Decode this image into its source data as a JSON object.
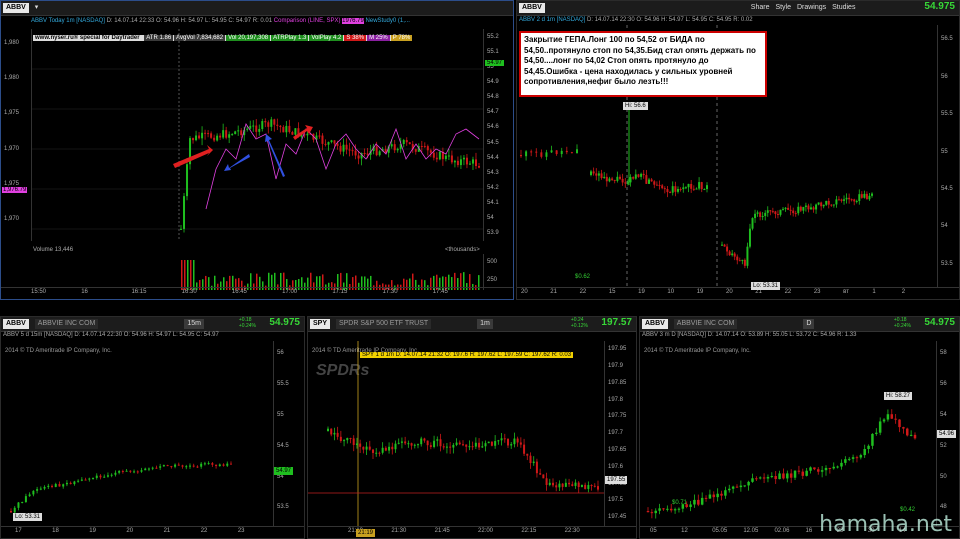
{
  "colors": {
    "up": "#1fbf1f",
    "down": "#d01818",
    "price": "#37d737",
    "compare": "#e040e0",
    "bg": "#000000"
  },
  "p1": {
    "symbol": "ABBV",
    "title": "ABBV Today 1m [NASDAQ]",
    "ohlc": {
      "d": "D: 14.07.14 22:33",
      "o": "O: 54.96",
      "h": "H: 54.97",
      "l": "L: 54.95",
      "c": "C: 54.97",
      "r": "R: 0.01"
    },
    "comparison": "Comparison (LINE, SPX)",
    "comparison_val": "1976.79",
    "newstudy": "NewStudy0 (1,...",
    "site": "www.nyser.ru® special for Daytrader",
    "chips": [
      {
        "t": "ATR 1.86",
        "c": "#3a3a3a"
      },
      {
        "t": "AvgVol 7,834,682",
        "c": "#3a3a3a"
      },
      {
        "t": "Vol 20,197,308",
        "c": "#1f8f1f"
      },
      {
        "t": "ATRPlay 1.3",
        "c": "#1f8f1f"
      },
      {
        "t": "VolPlay 4.2",
        "c": "#1f8f1f"
      },
      {
        "t": "S 38%",
        "c": "#d01818"
      },
      {
        "t": "M 25%",
        "c": "#8a1fa0"
      },
      {
        "t": "P 78%",
        "c": "#c8a020"
      }
    ],
    "price_label": "54.97",
    "left_axis": [
      "1,980",
      "1,980",
      "1,975",
      "1,970",
      "1,975",
      "1,970"
    ],
    "right_axis": [
      "55.2",
      "55.1",
      "55",
      "54.9",
      "54.8",
      "54.7",
      "54.6",
      "54.5",
      "54.4",
      "54.3",
      "54.2",
      "54.1",
      "54",
      "53.9"
    ],
    "left_marker": "1,976.79",
    "volume_label": "Volume",
    "volume_value": "13,446",
    "thousands": "<thousands>",
    "vol_axis": [
      "500",
      "250"
    ],
    "xaxis": [
      "15:50",
      "16",
      "16:15",
      "16:30",
      "16:45",
      "17:00",
      "17:15",
      "17:30",
      "17:45"
    ],
    "time_chip": "2014 © 13.4"
  },
  "p2": {
    "symbol": "ABBV",
    "title": "ABBV 2 d 1m [NASDAQ]",
    "ohlc": {
      "d": "D: 14.07.14 22:30",
      "o": "O: 54.96",
      "h": "H: 54.97",
      "l": "L: 54.95",
      "c": "C: 54.95",
      "r": "R: 0.02"
    },
    "price": "54.975",
    "hi": "Hi: 56.6",
    "lo": "Lo: 53.31",
    "tag1": "$0.62",
    "right_axis": [
      "56.5",
      "56",
      "55.5",
      "55",
      "54.5",
      "54",
      "53.5"
    ],
    "xaxis": [
      "20",
      "21",
      "22",
      "15",
      "19",
      "10",
      "19",
      "20",
      "21",
      "22",
      "23",
      "вт",
      "1",
      "2"
    ]
  },
  "note": "Закрытие ГЕПА.Лонг 100 по 54,52 от БИДА по 54,50..протянуло стоп по 54,35.Бид стал опять держать по 54,50....лонг по 54,02 Стоп опять протянуло до 54,45.Ошибка - цена находилась у сильных уровней сопротивления,нефиг было лезть!!!",
  "p3": {
    "symbol": "ABBV",
    "desc": "ABBVIE INC COM",
    "tf": "15m",
    "price": "54.975",
    "chg": "+0.18\n+0.24%",
    "info": "ABBV 5 d 15m [NASDAQ]   D: 14.07.14 22:30  O: 54.96  H: 54.97  L: 54.95  C: 54.97",
    "copyright": "2014 © TD Ameritrade IP Company, Inc.",
    "price_label": "54.97",
    "lo": "Lo: 53.31",
    "right_axis": [
      "56",
      "55.5",
      "55",
      "54.5",
      "54",
      "53.5"
    ],
    "xaxis": [
      "17",
      "18",
      "19",
      "20",
      "21",
      "22",
      "23"
    ]
  },
  "p4": {
    "symbol": "SPY",
    "desc": "SPDR S&P 500 ETF TRUST",
    "tf": "1m",
    "price": "197.57",
    "chg": "+0.24\n+0.12%",
    "info": "SPY 1 d 1m  D: 14.07.14 21:32  O: 197.6  H: 197.62  L: 197.59  C: 197.62  R: 0.03",
    "copyright": "2014 © TD Ameritrade IP Company, Inc.",
    "wm": "SPDRs",
    "price_label": "197.55",
    "right_axis": [
      "197.95",
      "197.9",
      "197.85",
      "197.8",
      "197.75",
      "197.7",
      "197.65",
      "197.6",
      "197.55",
      "197.5",
      "197.45"
    ],
    "xaxis": [
      "21:19",
      "21:30",
      "21:45",
      "22:00",
      "22:15",
      "22:30"
    ]
  },
  "p5": {
    "symbol": "ABBV",
    "desc": "ABBVIE INC COM",
    "tf": "D",
    "price": "54.975",
    "chg": "+0.18\n+0.24%",
    "info": "ABBV 3 m D [NASDAQ]   D: 14.07.14  O: 53.89  H: 55.05  L: 53.72  C: 54.96  R: 1.33",
    "copyright": "2014 © TD Ameritrade IP Company, Inc.",
    "hi": "Hi: 58.27",
    "price_label": "54.96",
    "tag1": "$0.71",
    "tag2": "$0.42",
    "right_axis": [
      "58",
      "56",
      "54",
      "52",
      "50",
      "48"
    ],
    "xaxis": [
      "05",
      "12",
      "05.05",
      "12.05",
      "02.06",
      "16",
      "23",
      "30",
      "14"
    ]
  },
  "toolbar": {
    "share": "Share",
    "style": "Style",
    "drawings": "Drawings",
    "studies": "Studies"
  },
  "watermark": "hamaha.net"
}
